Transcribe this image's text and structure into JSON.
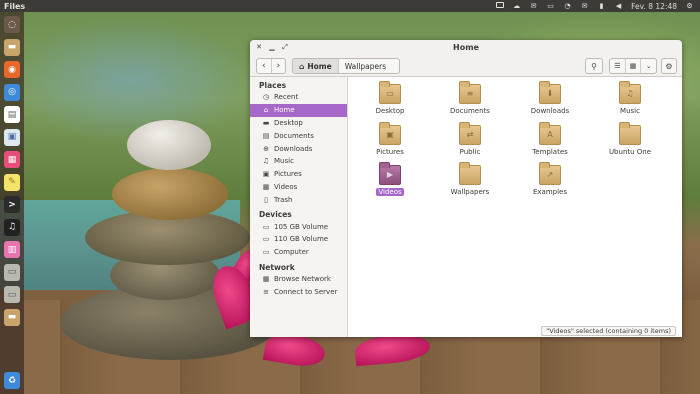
{
  "top_panel": {
    "app_title": "Files",
    "datetime": "Fev. 8 12:48"
  },
  "launcher": {
    "icons": [
      "dash-icon",
      "files-icon",
      "firefox-icon",
      "chromium-icon",
      "document-icon",
      "image-viewer-icon",
      "store-icon",
      "notes-icon",
      "terminal-icon",
      "music-icon",
      "equalizer-icon",
      "drive-icon",
      "drive-icon",
      "folder-icon",
      "trash-icon"
    ]
  },
  "window": {
    "title": "Home",
    "path": [
      "Home",
      "Wallpapers"
    ]
  },
  "sidebar": {
    "places_header": "Places",
    "places": [
      {
        "label": "Recent",
        "icon": "clock-icon"
      },
      {
        "label": "Home",
        "icon": "home-icon"
      },
      {
        "label": "Desktop",
        "icon": "desktop-icon"
      },
      {
        "label": "Documents",
        "icon": "documents-icon"
      },
      {
        "label": "Downloads",
        "icon": "downloads-icon"
      },
      {
        "label": "Music",
        "icon": "music-icon"
      },
      {
        "label": "Pictures",
        "icon": "pictures-icon"
      },
      {
        "label": "Videos",
        "icon": "videos-icon"
      },
      {
        "label": "Trash",
        "icon": "trash-icon"
      }
    ],
    "devices_header": "Devices",
    "devices": [
      {
        "label": "105 GB Volume",
        "icon": "drive-icon"
      },
      {
        "label": "110 GB Volume",
        "icon": "drive-icon"
      },
      {
        "label": "Computer",
        "icon": "computer-icon"
      }
    ],
    "network_header": "Network",
    "network": [
      {
        "label": "Browse Network",
        "icon": "network-icon"
      },
      {
        "label": "Connect to Server",
        "icon": "server-icon"
      }
    ]
  },
  "files": [
    {
      "name": "Desktop",
      "glyph": "▭"
    },
    {
      "name": "Documents",
      "glyph": "≡"
    },
    {
      "name": "Downloads",
      "glyph": "⬇"
    },
    {
      "name": "Music",
      "glyph": "♫"
    },
    {
      "name": "Pictures",
      "glyph": "▣"
    },
    {
      "name": "Public",
      "glyph": "⇄"
    },
    {
      "name": "Templates",
      "glyph": "A"
    },
    {
      "name": "Ubuntu One",
      "glyph": ""
    },
    {
      "name": "Videos",
      "glyph": "▶"
    },
    {
      "name": "Wallpapers",
      "glyph": ""
    },
    {
      "name": "Examples",
      "glyph": "↗"
    }
  ],
  "status": "\"Videos\" selected (containing 0 items)"
}
